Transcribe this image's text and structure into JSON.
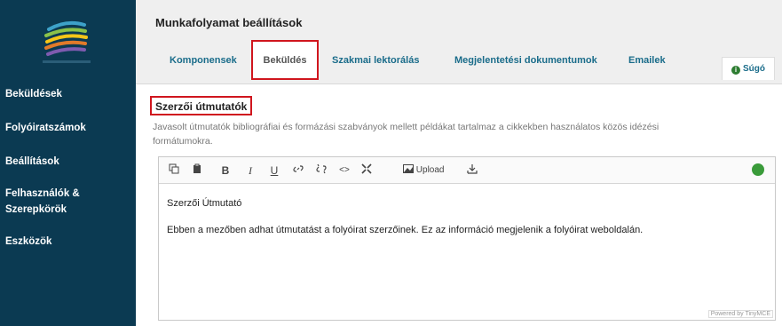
{
  "sidebar": {
    "items": [
      {
        "label": "Beküldések"
      },
      {
        "label": "Folyóiratszámok"
      },
      {
        "label": "Beállítások"
      },
      {
        "label": "Felhasználók &"
      },
      {
        "label": "Szerepkörök"
      },
      {
        "label": "Eszközök"
      }
    ]
  },
  "header": {
    "title": "Munkafolyamat beállítások",
    "tabs": [
      {
        "label": "Komponensek"
      },
      {
        "label": "Beküldés"
      },
      {
        "label": "Szakmai lektorálás"
      },
      {
        "label": "Megjelentetési dokumentumok"
      },
      {
        "label": "Emailek"
      }
    ],
    "help_label": "Súgó"
  },
  "section": {
    "title": "Szerzői útmutatók",
    "description_line1": "Javasolt útmutatók bibliográfiai és formázási szabványok mellett példákat tartalmaz a cikkekben használatos közös idézési",
    "description_line2": "formátumokra."
  },
  "editor": {
    "upload_label": "Upload",
    "content": [
      "Szerzői Útmutató",
      "Ebben a mezőben adhat útmutatást a folyóirat szerzőinek. Ez az információ megjelenik a folyóirat weboldalán."
    ],
    "powered_by": "Powered by TinyMCE"
  },
  "colors": {
    "sidebar_bg": "#0b3a52",
    "tab_link": "#1a6c8a",
    "highlight": "#d0161e"
  }
}
